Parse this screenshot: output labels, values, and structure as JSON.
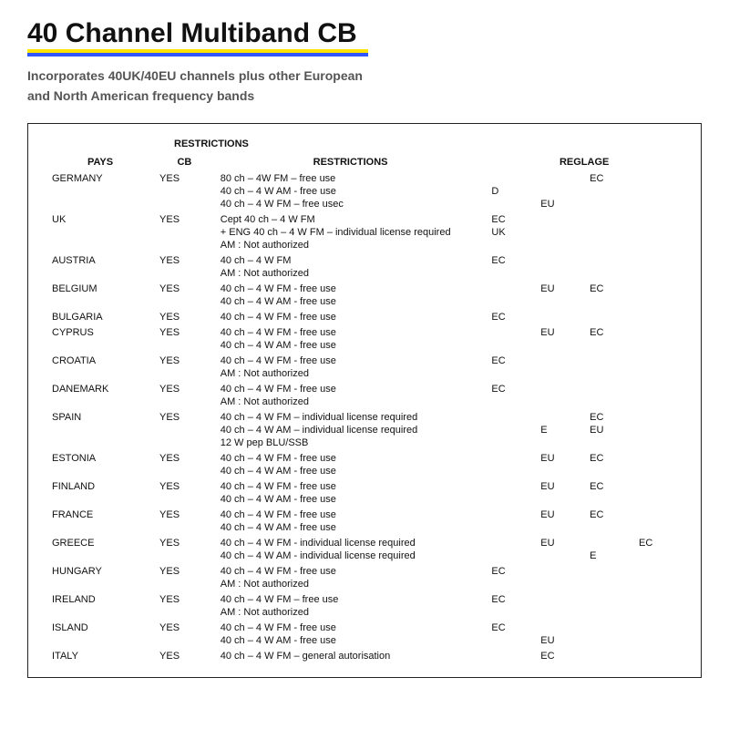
{
  "title": "40 Channel Multiband CB",
  "subtitle_l1": "Incorporates 40UK/40EU channels plus other European",
  "subtitle_l2": "and North American frequency bands",
  "section_header": "RESTRICTIONS",
  "headers": {
    "pays": "PAYS",
    "cb": "CB",
    "restrictions": "RESTRICTIONS",
    "reglage": "REGLAGE"
  },
  "rows": [
    {
      "pays": "GERMANY",
      "cb": "YES",
      "restr": [
        "80 ch – 4W FM – free use",
        "40 ch – 4 W AM - free use",
        "40 ch – 4 W FM – free usec"
      ],
      "reg": [
        "",
        "D",
        ""
      ],
      "reg_mid": [
        "",
        "",
        "EU"
      ],
      "reg_last": [
        "EC",
        "",
        ""
      ]
    },
    {
      "pays": "UK",
      "cb": "YES",
      "restr": [
        "Cept 40 ch – 4 W FM",
        "+ ENG 40 ch – 4 W FM – individual license required",
        "AM : Not authorized"
      ],
      "reg": [
        "EC",
        "UK",
        ""
      ],
      "reg_mid": [
        "",
        "",
        ""
      ],
      "reg_last": [
        "",
        "",
        ""
      ]
    },
    {
      "pays": "AUSTRIA",
      "cb": "YES",
      "restr": [
        "40 ch – 4 W FM",
        "AM : Not authorized"
      ],
      "reg": [
        "EC",
        ""
      ],
      "reg_mid": [
        "",
        ""
      ],
      "reg_last": [
        "",
        ""
      ]
    },
    {
      "pays": "BELGIUM",
      "cb": "YES",
      "restr": [
        "40 ch – 4 W FM - free use",
        "40 ch – 4 W AM - free use"
      ],
      "reg": [
        "",
        ""
      ],
      "reg_mid": [
        "EU",
        ""
      ],
      "reg_last": [
        "EC",
        ""
      ]
    },
    {
      "pays": "BULGARIA",
      "cb": "YES",
      "restr": [
        "40 ch – 4 W FM - free use"
      ],
      "reg": [
        "EC"
      ],
      "reg_mid": [
        ""
      ],
      "reg_last": [
        ""
      ]
    },
    {
      "pays": "CYPRUS",
      "cb": "YES",
      "restr": [
        "40 ch – 4 W FM - free use",
        "40 ch – 4 W AM - free use"
      ],
      "reg": [
        "",
        ""
      ],
      "reg_mid": [
        "EU",
        ""
      ],
      "reg_last": [
        "EC",
        ""
      ]
    },
    {
      "pays": "CROATIA",
      "cb": "YES",
      "restr": [
        "40 ch – 4 W FM - free use",
        "AM : Not authorized"
      ],
      "reg": [
        "EC",
        ""
      ],
      "reg_mid": [
        "",
        ""
      ],
      "reg_last": [
        "",
        ""
      ]
    },
    {
      "pays": "DANEMARK",
      "cb": "YES",
      "restr": [
        "40 ch – 4 W FM - free use",
        "AM : Not authorized"
      ],
      "reg": [
        "EC",
        ""
      ],
      "reg_mid": [
        "",
        ""
      ],
      "reg_last": [
        "",
        ""
      ]
    },
    {
      "pays": "SPAIN",
      "cb": "YES",
      "restr": [
        "40 ch – 4 W FM – individual license required",
        "40 ch – 4 W AM – individual license required",
        "12 W pep BLU/SSB"
      ],
      "reg": [
        "",
        "",
        ""
      ],
      "reg_mid": [
        "",
        "E",
        ""
      ],
      "reg_last": [
        "EC",
        "EU",
        ""
      ]
    },
    {
      "pays": "ESTONIA",
      "cb": "YES",
      "restr": [
        "40 ch – 4 W FM - free use",
        "40 ch – 4 W AM - free use"
      ],
      "reg": [
        "",
        ""
      ],
      "reg_mid": [
        "EU",
        ""
      ],
      "reg_last": [
        "EC",
        ""
      ]
    },
    {
      "pays": "FINLAND",
      "cb": "YES",
      "restr": [
        "40 ch – 4 W FM - free use",
        "40 ch – 4 W AM - free use"
      ],
      "reg": [
        "",
        ""
      ],
      "reg_mid": [
        "EU",
        ""
      ],
      "reg_last": [
        "EC",
        ""
      ]
    },
    {
      "pays": "FRANCE",
      "cb": "YES",
      "restr": [
        "40 ch – 4 W FM - free use",
        "40 ch – 4 W AM - free use"
      ],
      "reg": [
        "",
        ""
      ],
      "reg_mid": [
        "EU",
        ""
      ],
      "reg_last": [
        "EC",
        ""
      ]
    },
    {
      "pays": "GREECE",
      "cb": "YES",
      "restr": [
        "40 ch – 4 W FM - individual license required",
        "40 ch – 4 W AM - individual license required"
      ],
      "reg": [
        "",
        ""
      ],
      "reg_mid": [
        "EU",
        ""
      ],
      "reg_last": [
        "",
        "E"
      ],
      "reg_extra": [
        "EC",
        ""
      ]
    },
    {
      "pays": "HUNGARY",
      "cb": "YES",
      "restr": [
        "40 ch – 4 W FM - free use",
        "AM : Not authorized"
      ],
      "reg": [
        "EC",
        ""
      ],
      "reg_mid": [
        "",
        ""
      ],
      "reg_last": [
        "",
        ""
      ]
    },
    {
      "pays": "IRELAND",
      "cb": "YES",
      "restr": [
        "40 ch – 4 W FM – free use",
        "AM : Not authorized"
      ],
      "reg": [
        "EC",
        ""
      ],
      "reg_mid": [
        "",
        ""
      ],
      "reg_last": [
        "",
        ""
      ]
    },
    {
      "pays": "ISLAND",
      "cb": "YES",
      "restr": [
        "40 ch – 4 W FM - free use",
        "40 ch – 4 W AM - free use"
      ],
      "reg": [
        "EC",
        ""
      ],
      "reg_mid": [
        "",
        "EU"
      ],
      "reg_last": [
        "",
        ""
      ]
    },
    {
      "pays": "ITALY",
      "cb": "YES",
      "restr": [
        "40 ch – 4 W FM – general autorisation"
      ],
      "reg": [
        ""
      ],
      "reg_mid": [
        "EC"
      ],
      "reg_last": [
        ""
      ]
    }
  ]
}
